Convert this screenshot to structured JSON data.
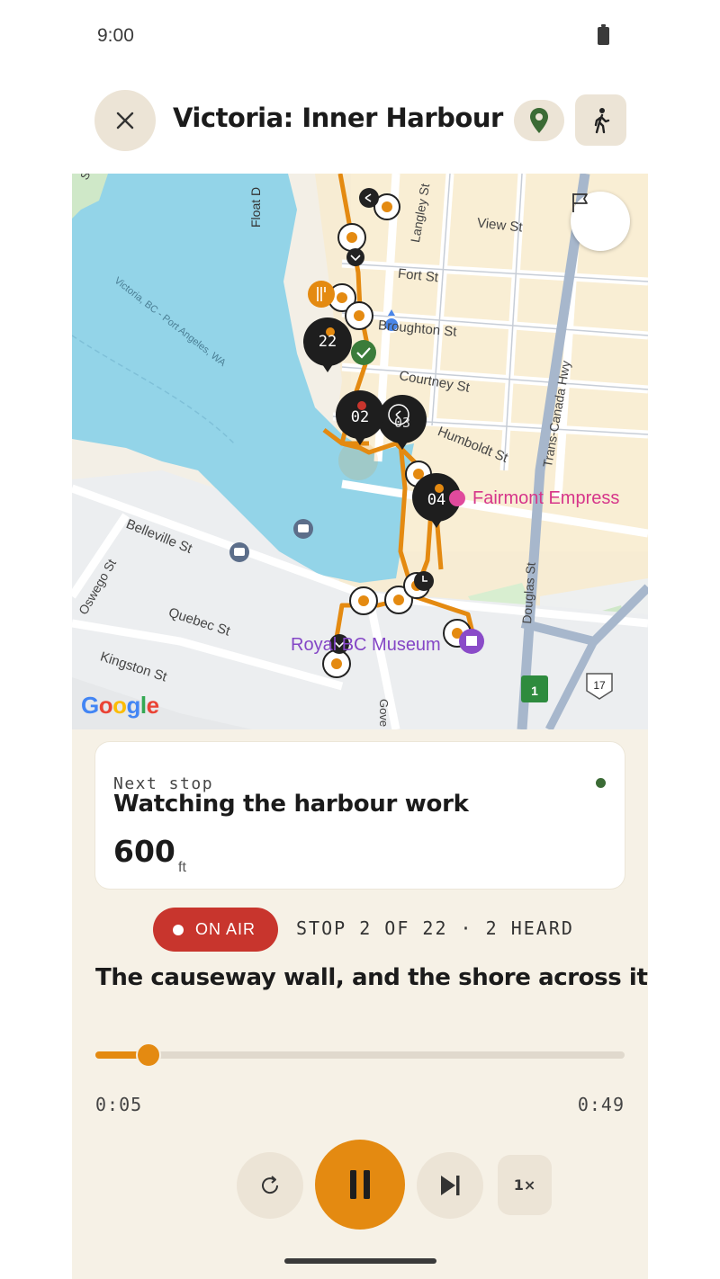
{
  "status_bar": {
    "time": "9:00"
  },
  "header": {
    "title": "Victoria: Inner Harbour"
  },
  "map": {
    "streets": [
      "Float D",
      "Langley St",
      "View St",
      "Fort St",
      "Broughton St",
      "Courtney St",
      "Humboldt St",
      "Trans-Canada Hwy",
      "Douglas St",
      "Belleville St",
      "Oswego St",
      "Quebec St",
      "Kingston St",
      "Gove",
      "Victoria, BC - Port Angeles, WA",
      "So"
    ],
    "places": {
      "fairmont": "Fairmont Empress",
      "museum": "Royal BC Museum"
    },
    "stop_markers": [
      "22",
      "02",
      "03",
      "04"
    ],
    "road_shields": [
      "1",
      "17"
    ],
    "attribution": "Google",
    "route_color": "#e48a11",
    "water_color": "#93d4e8"
  },
  "next_stop": {
    "label": "Next stop",
    "title": "Watching the harbour work",
    "distance": "600",
    "unit": "ft",
    "status_color": "#3b6b35"
  },
  "now_playing": {
    "badge": "ON AIR",
    "stop_info": "STOP 2 OF 22 · 2 HEARD",
    "clip_title": "The causeway wall, and the shore across it",
    "current_time": "0:05",
    "total_time": "0:49",
    "progress": 0.1,
    "speed": "1×"
  },
  "colors": {
    "accent": "#e48a11",
    "onair": "#c8352d",
    "panel": "#f6f1e6",
    "chip": "#ece4d6"
  }
}
